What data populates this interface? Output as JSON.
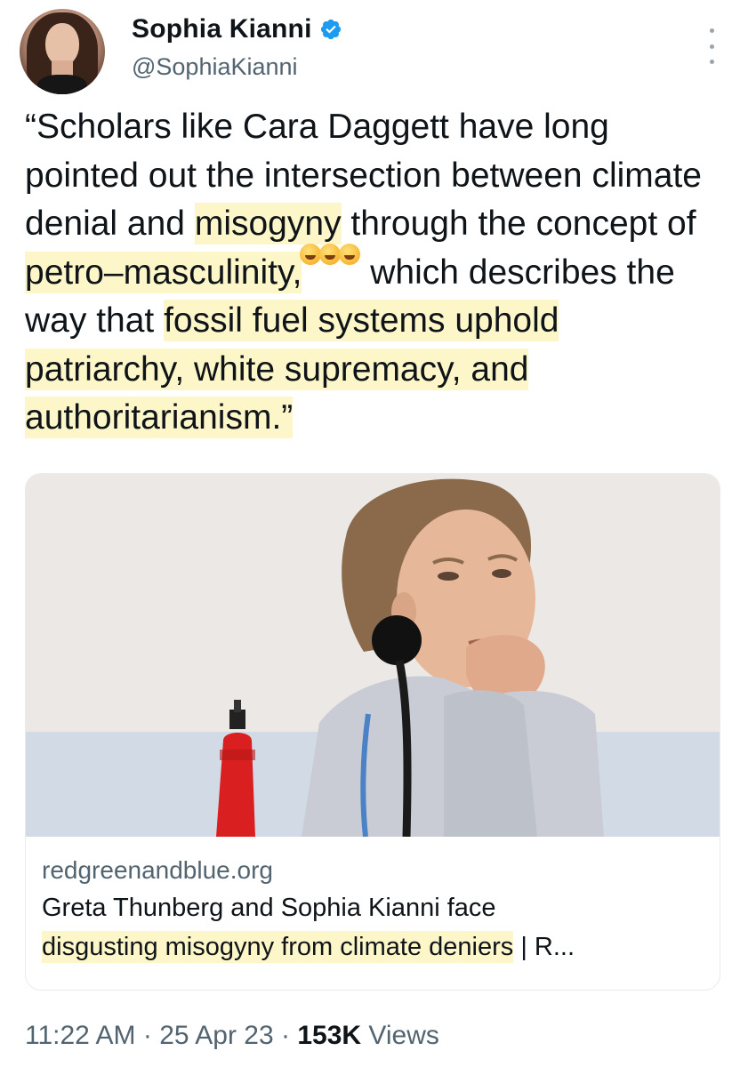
{
  "header": {
    "display_name": "Sophia Kianni",
    "handle": "@SophiaKianni",
    "verified": true,
    "more_icon": "more-vertical-icon"
  },
  "tweet": {
    "segments": [
      {
        "text": "“Scholars like Cara Daggett have long pointed out the intersection between climate denial and ",
        "highlight": false
      },
      {
        "text": "misogyny",
        "highlight": true
      },
      {
        "text": " through the concept of ",
        "highlight": false
      },
      {
        "text": "petro–masculinity,",
        "highlight": true
      },
      {
        "text": "🤣🤣🤣",
        "emoji": true
      },
      {
        "text": " which describes the way that ",
        "highlight": false
      },
      {
        "text": "fossil fuel systems uphold patriarchy, white supremacy, and authoritarianism.”",
        "highlight": true
      }
    ]
  },
  "card": {
    "domain": "redgreenandblue.org",
    "title_plain": "Greta Thunberg and Sophia Kianni face",
    "title_highlight": "disgusting misogyny from climate deniers",
    "title_tail": " | R..."
  },
  "footer": {
    "time": "11:22 AM",
    "date": "25 Apr 23",
    "views_count": "153K",
    "views_label": "Views",
    "separator": "·"
  },
  "colors": {
    "highlight": "#fdf6c8",
    "verified_blue": "#1d9bf0",
    "secondary_text": "#536471"
  }
}
